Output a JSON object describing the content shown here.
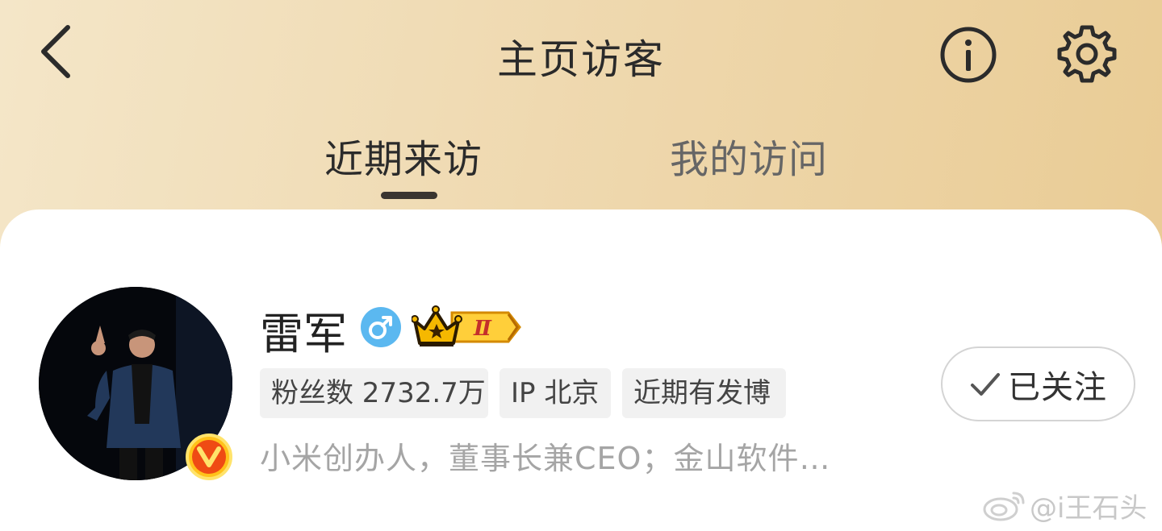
{
  "header": {
    "title": "主页访客",
    "back_icon": "chevron-left-icon",
    "info_icon": "info-icon",
    "settings_icon": "gear-icon"
  },
  "tabs": [
    {
      "label": "近期来访",
      "active": true
    },
    {
      "label": "我的访问",
      "active": false
    }
  ],
  "visitor": {
    "name": "雷军",
    "gender_icon": "male-icon",
    "member_badge_icon": "crown-level-badge-icon",
    "member_badge_level": "Ⅱ",
    "verified_badge": "V",
    "tags": [
      "粉丝数 2732.7万",
      "IP 北京",
      "近期有发博"
    ],
    "bio": "小米创办人，董事长兼CEO；金山软件…",
    "follow_button": "已关注",
    "follow_icon": "checkmark-icon"
  },
  "watermark": {
    "text": "@i王石头",
    "icon": "weibo-logo-icon"
  },
  "colors": {
    "header_gradient_start": "#f4e6c8",
    "header_gradient_end": "#e9cb93",
    "verified_orange": "#ef4b14",
    "gender_blue": "#5bb8f0",
    "crown_gold": "#f5b800"
  }
}
